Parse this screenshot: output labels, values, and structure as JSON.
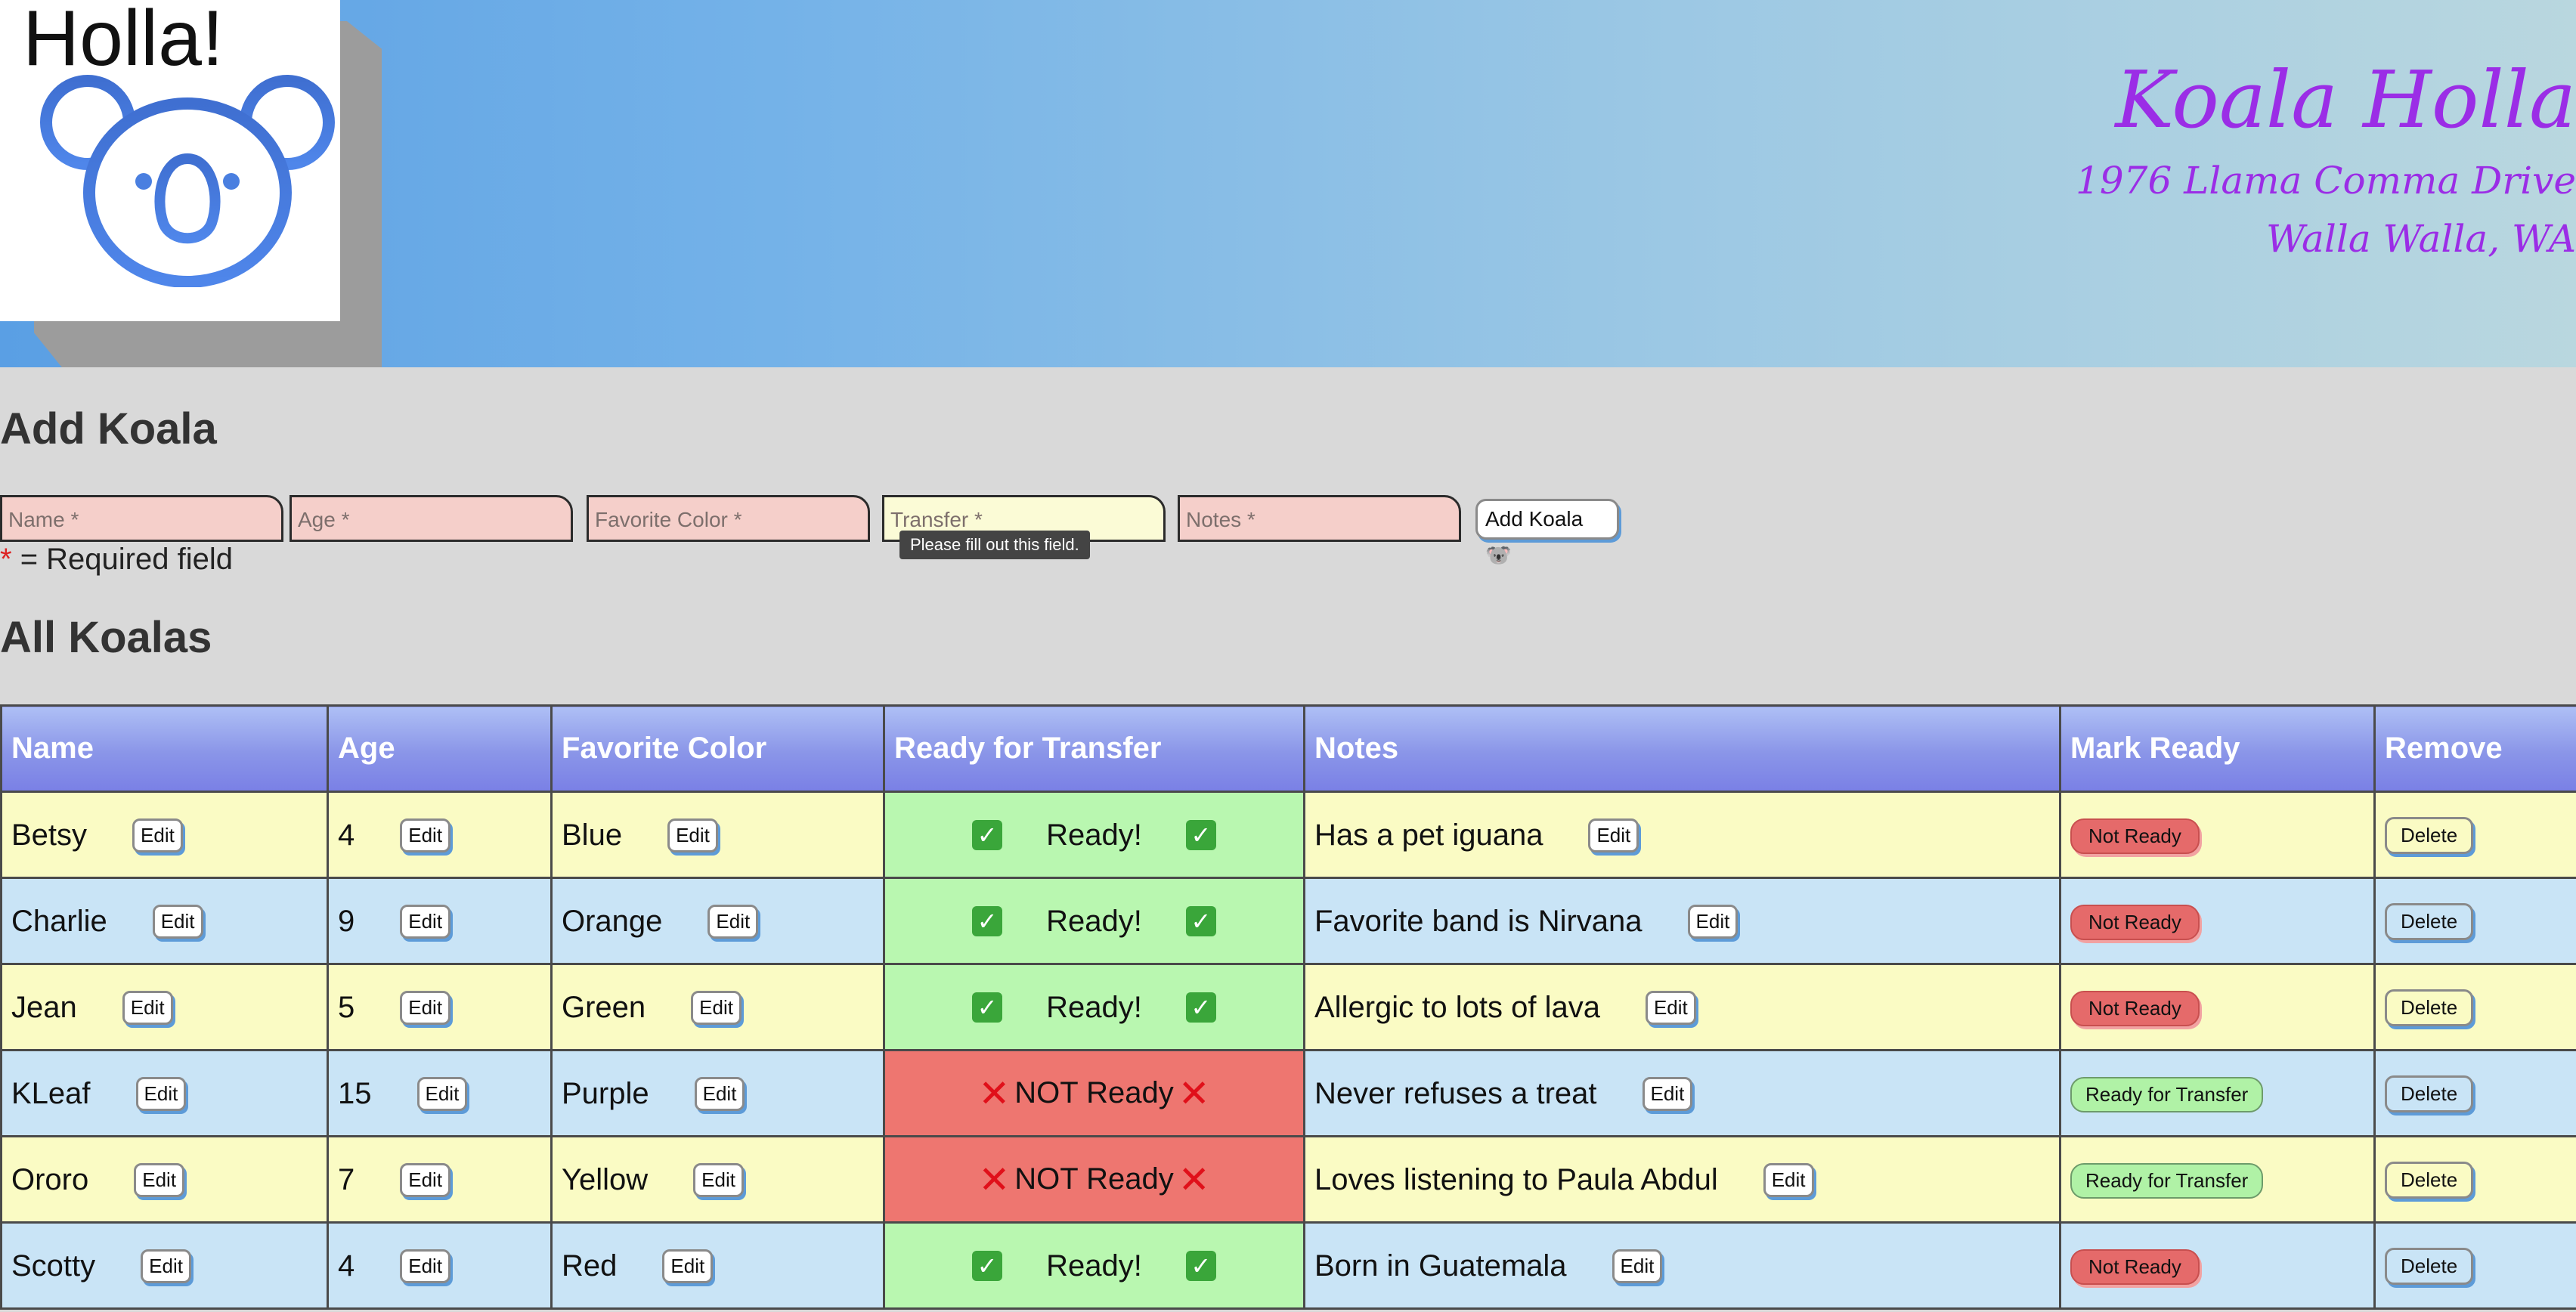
{
  "logo": {
    "text": "Holla!",
    "icon": "koala-icon"
  },
  "brand": {
    "name": "Koala Holla",
    "address_line1": "1976 Llama Comma Drive",
    "address_line2": "Walla Walla, WA"
  },
  "add_section": {
    "title": "Add Koala",
    "fields": [
      {
        "placeholder": "Name  *"
      },
      {
        "placeholder": "Age  *"
      },
      {
        "placeholder": "Favorite Color  *"
      },
      {
        "placeholder": "Transfer  *"
      },
      {
        "placeholder": "Notes  *"
      }
    ],
    "add_button": "Add Koala 🐨",
    "tooltip": "Please fill out this field.",
    "required_star": "*",
    "required_note": " = Required field"
  },
  "table_section": {
    "title": "All Koalas",
    "columns": [
      "Name",
      "Age",
      "Favorite Color",
      "Ready for Transfer",
      "Notes",
      "Mark Ready",
      "Remove"
    ],
    "edit_label": "Edit",
    "delete_label": "Delete",
    "ready_label": "Ready!",
    "not_ready_label": "NOT Ready",
    "mark_not_ready_label": "Not Ready",
    "mark_ready_label": "Ready for Transfer",
    "rows": [
      {
        "name": "Betsy",
        "age": "4",
        "color": "Blue",
        "ready": true,
        "notes": "Has a pet iguana"
      },
      {
        "name": "Charlie",
        "age": "9",
        "color": "Orange",
        "ready": true,
        "notes": "Favorite band is Nirvana"
      },
      {
        "name": "Jean",
        "age": "5",
        "color": "Green",
        "ready": true,
        "notes": "Allergic to lots of lava"
      },
      {
        "name": "KLeaf",
        "age": "15",
        "color": "Purple",
        "ready": false,
        "notes": "Never refuses a treat"
      },
      {
        "name": "Ororo",
        "age": "7",
        "color": "Yellow",
        "ready": false,
        "notes": "Loves listening to Paula Abdul"
      },
      {
        "name": "Scotty",
        "age": "4",
        "color": "Red",
        "ready": true,
        "notes": "Born in Guatemala"
      }
    ]
  },
  "colors": {
    "brand_purple": "#9b2de6",
    "ready_green": "#b9f7b0",
    "not_ready_red": "#ee7670",
    "row_yellow": "#fafbc4",
    "row_blue": "#c9e4f6"
  }
}
